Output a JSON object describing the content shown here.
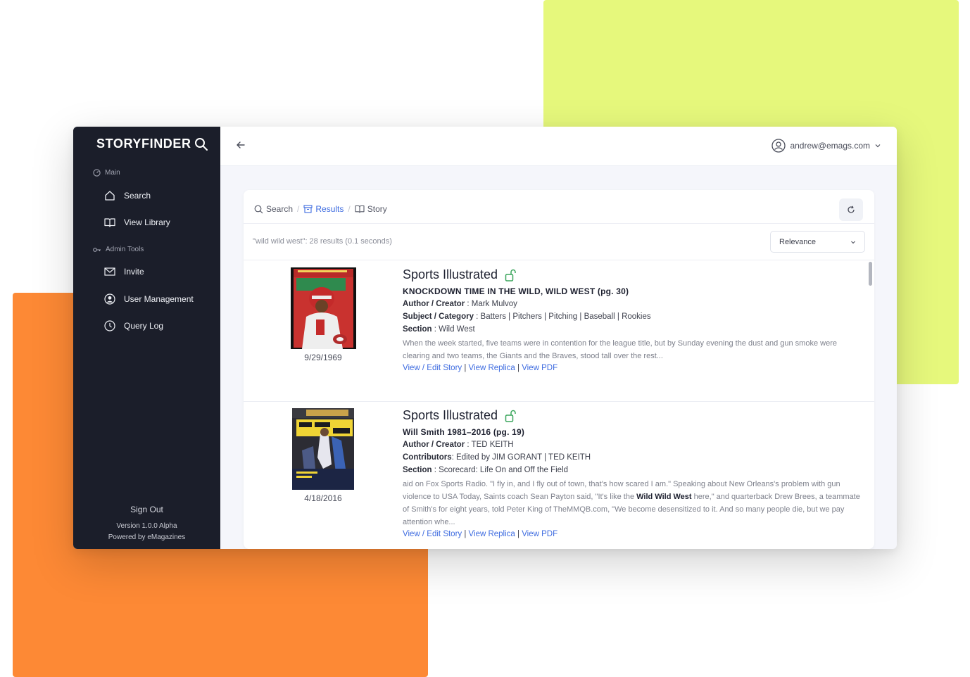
{
  "app": {
    "brand": "STORYFINDER",
    "colors": {
      "sidebar": "#1b1e2a",
      "accent": "#3d6be0",
      "lock": "#3aa55c",
      "bg_lime": "#e6f87c",
      "bg_orange": "#fd8935"
    }
  },
  "sidebar": {
    "section_main": "Main",
    "section_admin": "Admin Tools",
    "items": [
      {
        "label": "Search",
        "icon": "home-icon"
      },
      {
        "label": "View Library",
        "icon": "book-icon"
      },
      {
        "label": "Invite",
        "icon": "mail-icon"
      },
      {
        "label": "User Management",
        "icon": "user-circle-icon"
      },
      {
        "label": "Query Log",
        "icon": "clock-icon"
      }
    ],
    "sign_out": "Sign Out",
    "version": "Version 1.0.0 Alpha",
    "powered_by": "Powered by eMagazines"
  },
  "topbar": {
    "user_email": "andrew@emags.com"
  },
  "breadcrumb": {
    "search": "Search",
    "results": "Results",
    "story": "Story"
  },
  "results": {
    "summary": "\"wild wild west\": 28 results (0.1 seconds)",
    "sort_selected": "Relevance",
    "items": [
      {
        "publication": "Sports Illustrated",
        "date": "9/29/1969",
        "headline": "KNOCKDOWN TIME IN THE WILD, WILD WEST (pg. 30)",
        "meta1_label": "Author / Creator",
        "meta1_value": " : Mark Mulvoy",
        "meta2_label": "Subject / Category",
        "meta2_value": " : Batters | Pitchers | Pitching | Baseball | Rookies",
        "meta3_label": "Section",
        "meta3_value": " : Wild West",
        "snippet": "When the week started, five teams were in contention for the league title, but by Sunday evening the dust and gun smoke were clearing and two teams, the Giants and the Braves, stood tall over the rest...",
        "link_view": "View / Edit Story",
        "link_replica": "View Replica",
        "link_pdf": "View PDF"
      },
      {
        "publication": "Sports Illustrated",
        "date": "4/18/2016",
        "headline": "Will Smith 1981–2016 (pg. 19)",
        "meta1_label": "Author / Creator",
        "meta1_value": " : TED KEITH",
        "meta2_label": "Contributors",
        "meta2_value": ": Edited by JIM GORANT | TED KEITH",
        "meta3_label": "Section",
        "meta3_value": " : Scorecard: Life On and Off the Field",
        "snippet_pre": "aid on Fox Sports Radio. \"I fly in, and I fly out of town, that's how scared I am.\" Speaking about New Orleans's problem with gun violence to USA Today, Saints coach Sean Payton said, \"It's like the ",
        "snippet_bold": "Wild Wild West",
        "snippet_post": " here,\" and quarterback Drew Brees, a teammate of Smith's for eight years, told Peter King of TheMMQB.com, \"We become desensitized to it. And so many people die, but we pay attention whe...",
        "link_view": "View / Edit Story",
        "link_replica": "View Replica",
        "link_pdf": "View PDF",
        "cover_text": "HISTORY"
      }
    ]
  }
}
